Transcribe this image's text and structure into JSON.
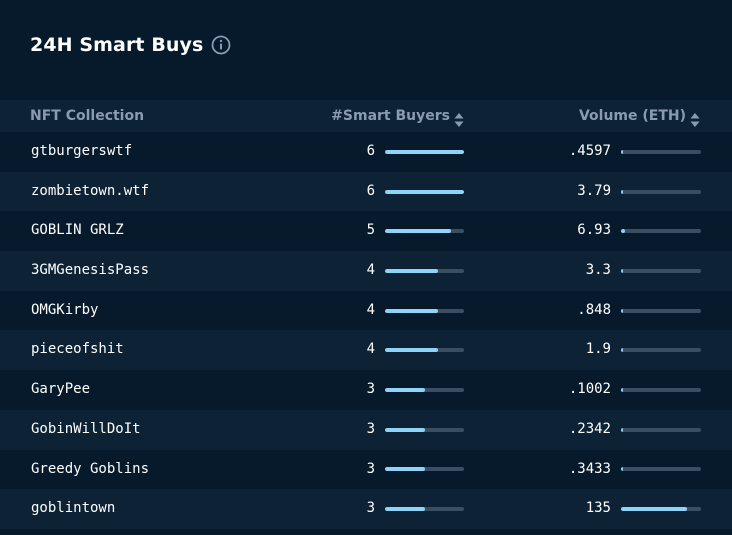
{
  "header": {
    "title": "24H Smart Buys",
    "info_icon": "info-icon"
  },
  "table": {
    "columns": {
      "name": "NFT Collection",
      "buyers": "#Smart Buyers",
      "volume": "Volume (ETH)"
    },
    "sort_icon": "sort-updown-icon",
    "max_buyers": 6,
    "max_volume": 135,
    "rows": [
      {
        "name": "gtburgerswtf",
        "buyers": "6",
        "buyers_num": 6,
        "volume": ".4597",
        "volume_num": 0.4597
      },
      {
        "name": "zombietown.wtf",
        "buyers": "6",
        "buyers_num": 6,
        "volume": "3.79",
        "volume_num": 3.79
      },
      {
        "name": "GOBLIN GRLZ",
        "buyers": "5",
        "buyers_num": 5,
        "volume": "6.93",
        "volume_num": 6.93
      },
      {
        "name": "3GMGenesisPass",
        "buyers": "4",
        "buyers_num": 4,
        "volume": "3.3",
        "volume_num": 3.3
      },
      {
        "name": "OMGKirby",
        "buyers": "4",
        "buyers_num": 4,
        "volume": ".848",
        "volume_num": 0.848
      },
      {
        "name": "pieceofshit",
        "buyers": "4",
        "buyers_num": 4,
        "volume": "1.9",
        "volume_num": 1.9
      },
      {
        "name": "GaryPee",
        "buyers": "3",
        "buyers_num": 3,
        "volume": ".1002",
        "volume_num": 0.1002
      },
      {
        "name": "GobinWillDoIt",
        "buyers": "3",
        "buyers_num": 3,
        "volume": ".2342",
        "volume_num": 0.2342
      },
      {
        "name": "Greedy Goblins",
        "buyers": "3",
        "buyers_num": 3,
        "volume": ".3433",
        "volume_num": 0.3433
      },
      {
        "name": "goblintown",
        "buyers": "3",
        "buyers_num": 3,
        "volume": "135",
        "volume_num": 135
      }
    ]
  },
  "colors": {
    "background": "#061a2c",
    "row_alt": "#0d2335",
    "header_text": "#8a9bb0",
    "bar_fill": "#8fd3f8",
    "bar_track": "#3b4d60"
  }
}
